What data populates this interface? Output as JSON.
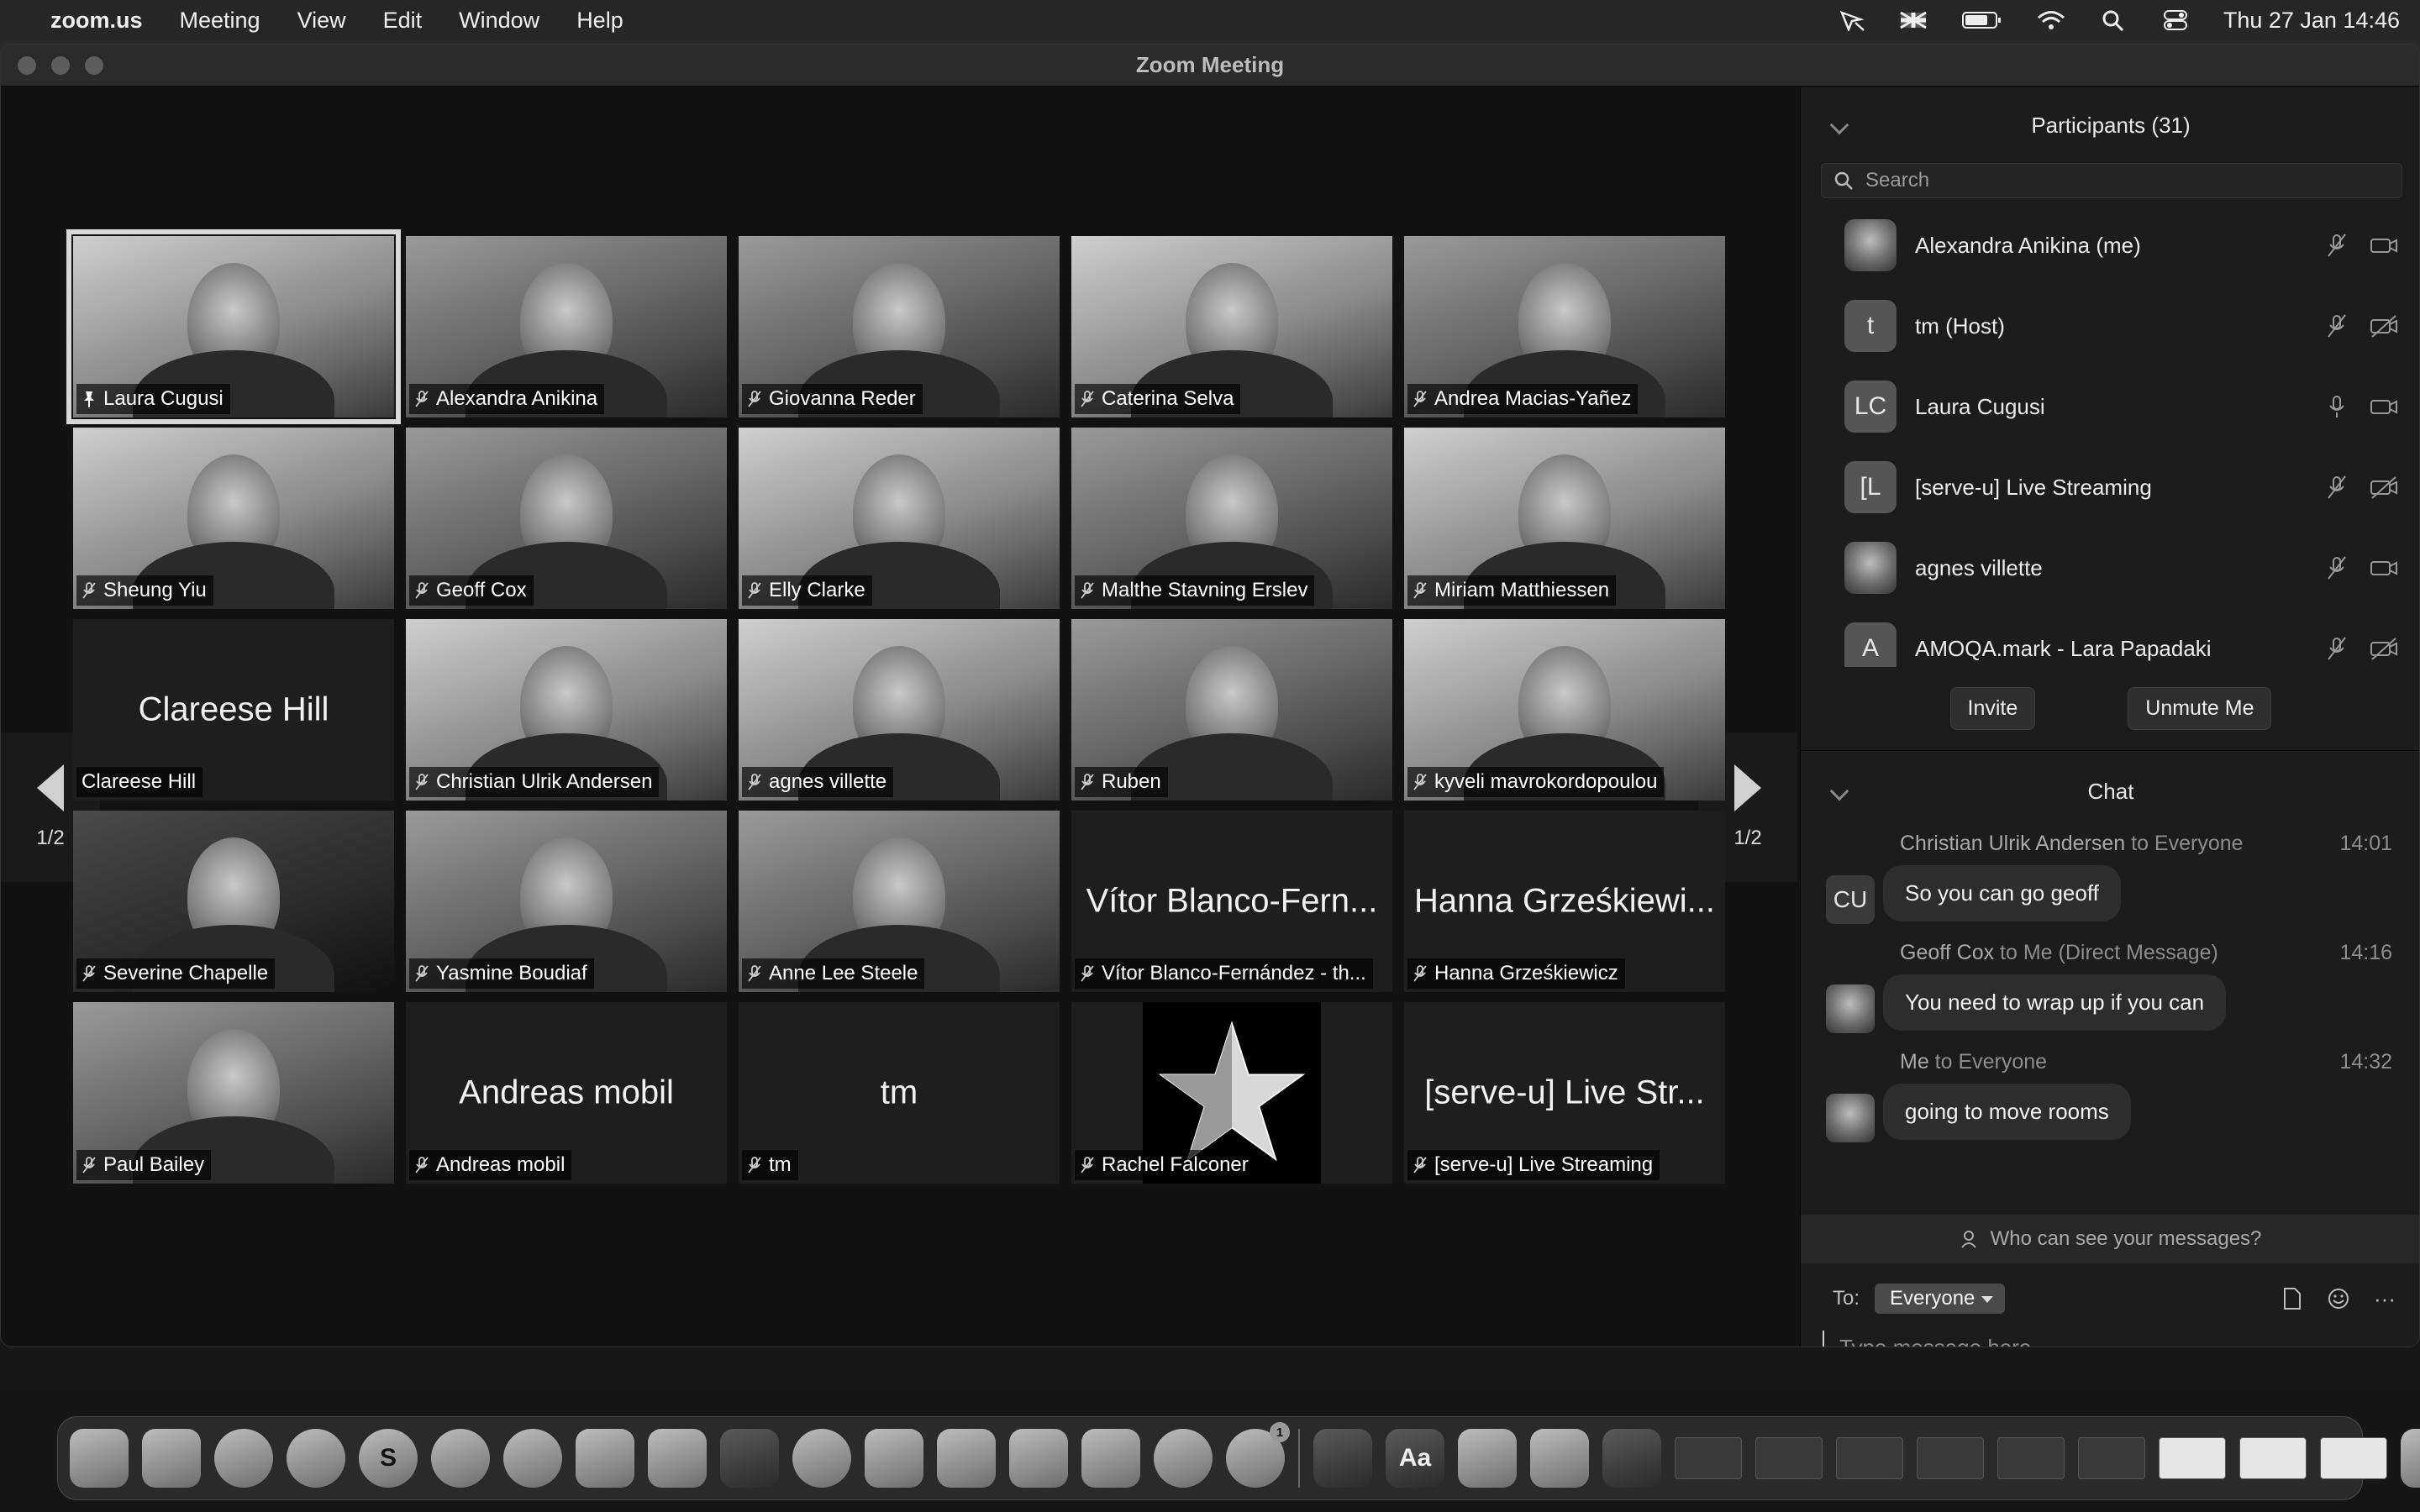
{
  "menubar": {
    "app_name": "zoom.us",
    "menus": [
      "Meeting",
      "View",
      "Edit",
      "Window",
      "Help"
    ],
    "clock": "Thu 27 Jan  14:46",
    "status_icons": [
      "location-off-icon",
      "uk-flag-icon",
      "battery-icon",
      "wifi-icon",
      "spotlight-search-icon",
      "control-center-icon"
    ]
  },
  "window": {
    "title": "Zoom Meeting"
  },
  "gallery": {
    "page_indicator": "1/2",
    "tiles": [
      {
        "name": "Laura Cugusi",
        "kind": "video",
        "tone": "light",
        "active": true,
        "mic": "pinned"
      },
      {
        "name": "Alexandra Anikina",
        "kind": "video",
        "tone": "mid",
        "mic": "muted"
      },
      {
        "name": "Giovanna Reder",
        "kind": "video",
        "tone": "mid",
        "mic": "muted"
      },
      {
        "name": "Caterina Selva",
        "kind": "video",
        "tone": "light",
        "mic": "muted"
      },
      {
        "name": "Andrea Macias-Yañez",
        "kind": "video",
        "tone": "mid",
        "mic": "muted"
      },
      {
        "name": "Sheung Yiu",
        "kind": "video",
        "tone": "light",
        "mic": "muted"
      },
      {
        "name": "Geoff Cox",
        "kind": "video",
        "tone": "mid",
        "mic": "muted"
      },
      {
        "name": "Elly Clarke",
        "kind": "video",
        "tone": "light",
        "mic": "muted"
      },
      {
        "name": "Malthe Stavning Erslev",
        "kind": "video",
        "tone": "mid",
        "mic": "muted"
      },
      {
        "name": "Miriam Matthiessen",
        "kind": "video",
        "tone": "light",
        "mic": "muted"
      },
      {
        "name": "Clareese Hill",
        "kind": "text",
        "display": "Clareese Hill",
        "mic": "none"
      },
      {
        "name": "Christian Ulrik Andersen",
        "kind": "video",
        "tone": "light",
        "mic": "muted"
      },
      {
        "name": "agnes villette",
        "kind": "video",
        "tone": "light",
        "mic": "muted"
      },
      {
        "name": "Ruben",
        "kind": "video",
        "tone": "mid",
        "mic": "muted"
      },
      {
        "name": "kyveli mavrokordopoulou",
        "kind": "video",
        "tone": "light",
        "mic": "muted"
      },
      {
        "name": "Severine Chapelle",
        "kind": "video",
        "tone": "dark",
        "mic": "muted"
      },
      {
        "name": "Yasmine Boudiaf",
        "kind": "video",
        "tone": "mid",
        "mic": "muted"
      },
      {
        "name": "Anne Lee Steele",
        "kind": "video",
        "tone": "mid",
        "mic": "muted"
      },
      {
        "name": "Vítor Blanco-Fernández - th...",
        "kind": "text",
        "display": "Vítor Blanco-Fern...",
        "mic": "muted"
      },
      {
        "name": "Hanna Grześkiewicz",
        "kind": "text",
        "display": "Hanna Grześkiewi...",
        "mic": "muted"
      },
      {
        "name": "Paul Bailey",
        "kind": "video",
        "tone": "mid",
        "mic": "muted"
      },
      {
        "name": "Andreas mobil",
        "kind": "text",
        "display": "Andreas mobil",
        "mic": "muted"
      },
      {
        "name": "tm",
        "kind": "text",
        "display": "tm",
        "mic": "muted"
      },
      {
        "name": "Rachel Falconer",
        "kind": "star",
        "mic": "muted"
      },
      {
        "name": "[serve-u] Live Streaming",
        "kind": "text",
        "display": "[serve-u] Live Str...",
        "mic": "muted"
      }
    ]
  },
  "participants": {
    "title": "Participants (31)",
    "search_placeholder": "Search",
    "list": [
      {
        "name": "Alexandra Anikina (me)",
        "avatar": "",
        "photo": true,
        "mic": "muted",
        "video": "on"
      },
      {
        "name": "tm (Host)",
        "avatar": "t",
        "photo": false,
        "mic": "muted",
        "video": "off"
      },
      {
        "name": "Laura Cugusi",
        "avatar": "LC",
        "photo": false,
        "mic": "on",
        "video": "on"
      },
      {
        "name": "[serve-u] Live Streaming",
        "avatar": "[L",
        "photo": false,
        "mic": "muted",
        "video": "off"
      },
      {
        "name": "agnes villette",
        "avatar": "",
        "photo": true,
        "mic": "muted",
        "video": "on"
      },
      {
        "name": "AMOQA.mark - Lara Papadaki",
        "avatar": "A",
        "photo": false,
        "mic": "muted",
        "video": "off"
      }
    ],
    "invite_label": "Invite",
    "unmute_label": "Unmute Me"
  },
  "chat": {
    "title": "Chat",
    "messages": [
      {
        "sender": "Christian Ulrik Andersen",
        "to": " to Everyone",
        "time": "14:01",
        "avatar": "CU",
        "photo": false,
        "text": "So you can go geoff"
      },
      {
        "sender": "Geoff Cox",
        "to": " to Me (Direct Message)",
        "time": "14:16",
        "avatar": "",
        "photo": true,
        "text": "You need to wrap up if you can"
      },
      {
        "sender": "Me",
        "to": " to Everyone",
        "time": "14:32",
        "avatar": "",
        "photo": true,
        "text": "going to move rooms"
      }
    ],
    "visibility_hint": "Who can see your messages?",
    "to_label": "To:",
    "recipient": "Everyone",
    "input_placeholder": "Type message here...",
    "more_label": "···"
  },
  "dock": {
    "apps": [
      {
        "name": "finder-icon",
        "glyph": ""
      },
      {
        "name": "launchpad-icon",
        "glyph": ""
      },
      {
        "name": "chrome-icon",
        "glyph": ""
      },
      {
        "name": "safari-icon",
        "glyph": ""
      },
      {
        "name": "skype-icon",
        "glyph": "S"
      },
      {
        "name": "telegram-icon",
        "glyph": ""
      },
      {
        "name": "whatsapp-icon",
        "glyph": ""
      },
      {
        "name": "notes-icon",
        "glyph": ""
      },
      {
        "name": "script-editor-icon",
        "glyph": ""
      },
      {
        "name": "kindle-icon",
        "glyph": ""
      },
      {
        "name": "utorrent-icon",
        "glyph": ""
      },
      {
        "name": "app-store-icon",
        "glyph": ""
      },
      {
        "name": "affinity-icon",
        "glyph": ""
      },
      {
        "name": "numbers-icon",
        "glyph": ""
      },
      {
        "name": "keynote-icon",
        "glyph": ""
      },
      {
        "name": "podcasts-icon",
        "glyph": ""
      },
      {
        "name": "system-preferences-icon",
        "glyph": "",
        "badge": "1"
      },
      {
        "name": "zoom-icon",
        "glyph": ""
      },
      {
        "name": "dictionary-icon",
        "glyph": "Aa"
      },
      {
        "name": "preview-icon",
        "glyph": ""
      },
      {
        "name": "downloads-stack-icon",
        "glyph": ""
      },
      {
        "name": "window-thumbnail-icon",
        "glyph": ""
      }
    ]
  }
}
